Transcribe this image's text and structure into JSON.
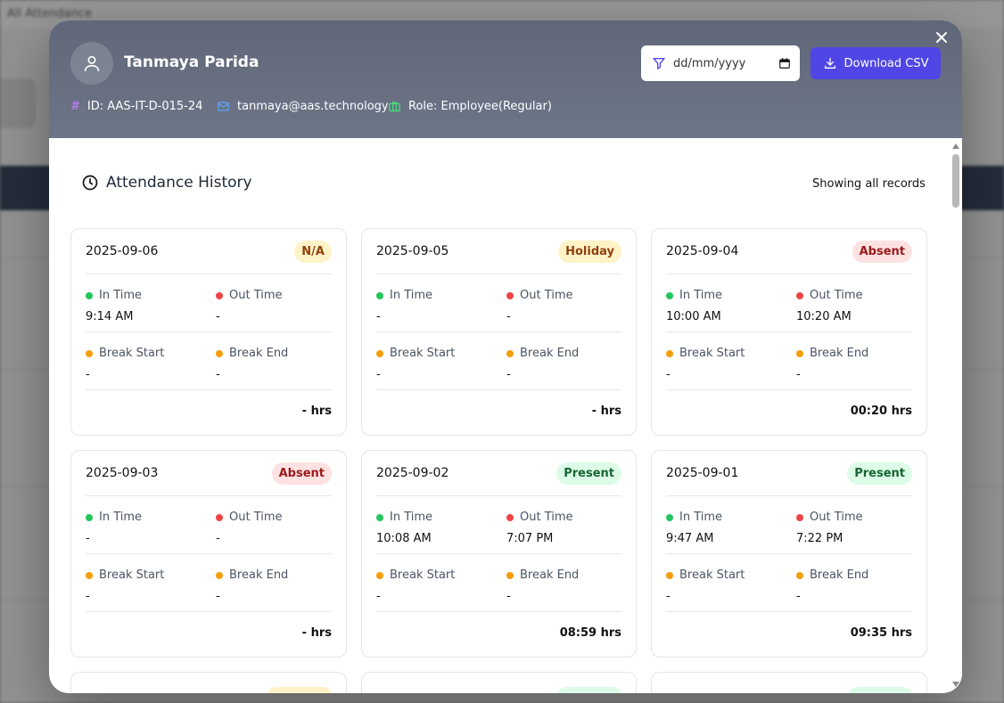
{
  "background": {
    "breadcrumb": "All Attendance"
  },
  "header": {
    "name": "Tanmaya Parida",
    "id": "ID: AAS-IT-D-015-24",
    "email": "tanmaya@aas.technology",
    "role": "Role: Employee(Regular)",
    "date_placeholder": "dd/mm/yyyy",
    "download_label": "Download CSV"
  },
  "history": {
    "title": "Attendance History",
    "showing": "Showing all records"
  },
  "labels": {
    "in_time": "In Time",
    "out_time": "Out Time",
    "break_start": "Break Start",
    "break_end": "Break End"
  },
  "colors": {
    "accent": "#4f46e5",
    "in_dot": "#22c55e",
    "out_dot": "#ef4444",
    "break_dot": "#f59e0b",
    "badge_na_bg": "#fef3c7",
    "badge_na_fg": "#92400e",
    "badge_holiday_bg": "#fef3c7",
    "badge_holiday_fg": "#92400e",
    "badge_absent_bg": "#fee2e2",
    "badge_absent_fg": "#991b1b",
    "badge_present_bg": "#dcfce7",
    "badge_present_fg": "#166534"
  },
  "cards": [
    {
      "date": "2025-09-06",
      "status": "N/A",
      "in_time": "9:14 AM",
      "out_time": "-",
      "break_start": "-",
      "break_end": "-",
      "hours": "- hrs"
    },
    {
      "date": "2025-09-05",
      "status": "Holiday",
      "in_time": "-",
      "out_time": "-",
      "break_start": "-",
      "break_end": "-",
      "hours": "- hrs"
    },
    {
      "date": "2025-09-04",
      "status": "Absent",
      "in_time": "10:00 AM",
      "out_time": "10:20 AM",
      "break_start": "-",
      "break_end": "-",
      "hours": "00:20 hrs"
    },
    {
      "date": "2025-09-03",
      "status": "Absent",
      "in_time": "-",
      "out_time": "-",
      "break_start": "-",
      "break_end": "-",
      "hours": "- hrs"
    },
    {
      "date": "2025-09-02",
      "status": "Present",
      "in_time": "10:08 AM",
      "out_time": "7:07 PM",
      "break_start": "-",
      "break_end": "-",
      "hours": "08:59 hrs"
    },
    {
      "date": "2025-09-01",
      "status": "Present",
      "in_time": "9:47 AM",
      "out_time": "7:22 PM",
      "break_start": "-",
      "break_end": "-",
      "hours": "09:35 hrs"
    }
  ],
  "partial_cards": [
    {
      "badge_color": "#fef3c7"
    },
    {
      "badge_color": "#dcfce7"
    },
    {
      "badge_color": "#dcfce7"
    }
  ]
}
